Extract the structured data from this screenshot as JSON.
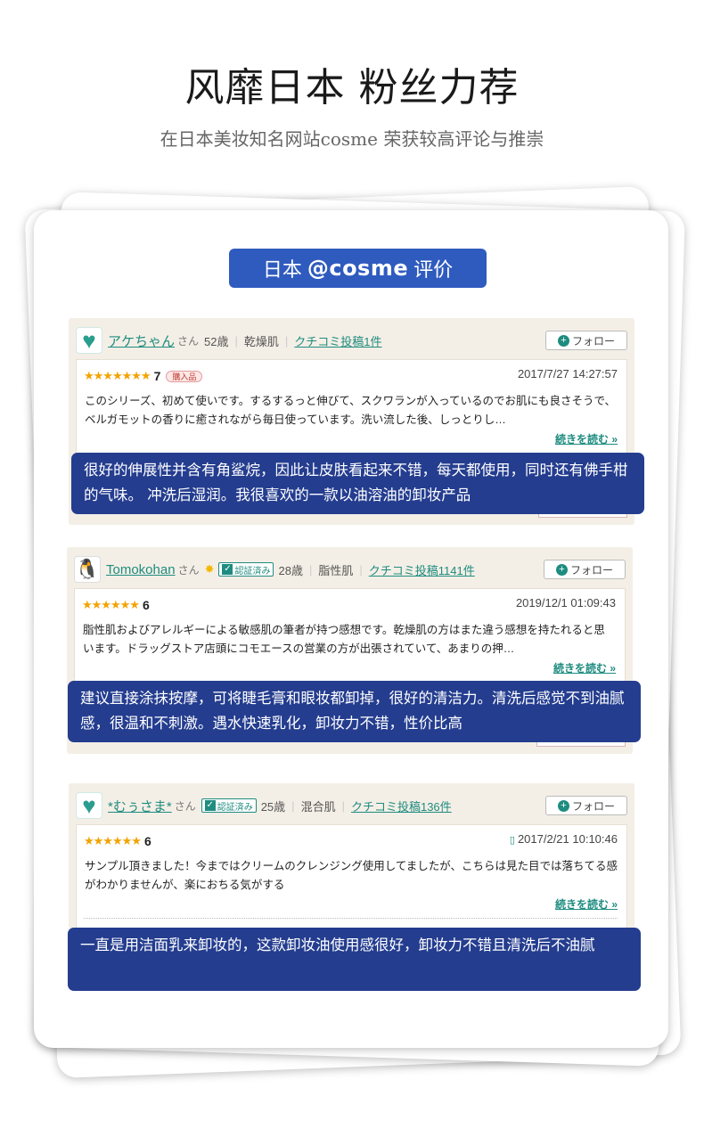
{
  "header": {
    "title": "风靡日本 粉丝力荐",
    "subtitle": "在日本美妆知名网站cosme 荣获较高评论与推崇"
  },
  "badge": {
    "prefix": "日本",
    "brand": "@cosme",
    "suffix": "评价"
  },
  "colors": {
    "accent": "#2f5bbf",
    "overlay": "#243d8f",
    "link": "#1e8c80",
    "star": "#f3a300"
  },
  "reviews": [
    {
      "avatar_icon": "heart-icon",
      "username": "アケちゃん",
      "san": "さん",
      "age": "52歳",
      "skin": "乾燥肌",
      "posts": "クチコミ投稿1件",
      "follow": "フォロー",
      "stars": "★★★★★★★",
      "score": "7",
      "purchased": "購入品",
      "date": "2017/7/27 14:27:57",
      "text": "このシリーズ、初めて使いです。するするっと伸びて、スクワランが入っているのでお肌にも良さそうで、ベルガモットの香りに癒されながら毎日使っています。洗い流した後、しっとりし…",
      "read_more": "続きを読む",
      "translation": "很好的伸展性并含有角鲨烷，因此让皮肤看起来不错，每天都使用，同时还有佛手柑的气味。 冲洗后湿润。我很喜欢的一款以油溶油的卸妆产品"
    },
    {
      "avatar_icon": "penguin-icon",
      "username": "Tomokohan",
      "san": "さん",
      "verified": "認証済み",
      "age": "28歳",
      "skin": "脂性肌",
      "posts": "クチコミ投稿1141件",
      "follow": "フォロー",
      "stars": "★★★★★★",
      "score": "6",
      "date": "2019/12/1 01:09:43",
      "text": "脂性肌およびアレルギーによる敏感肌の筆者が持つ感想です。乾燥肌の方はまた違う感想を持たれると思います。ドラッグストア店頭にコモエースの営業の方が出張されていて、あまりの押…",
      "read_more": "続きを読む",
      "translation": "建议直接涂抹按摩，可将睫毛膏和眼妆都卸掉，很好的清洁力。清洗后感觉不到油腻感，很温和不刺激。遇水快速乳化，卸妆力不错，性价比高"
    },
    {
      "avatar_icon": "heart-icon",
      "username": "*むぅさま*",
      "san": "さん",
      "verified": "認証済み",
      "age": "25歳",
      "skin": "混合肌",
      "posts": "クチコミ投稿136件",
      "follow": "フォロー",
      "stars": "★★★★★★",
      "score": "6",
      "date": "2017/2/21 10:10:46",
      "text": "サンプル頂きました！今まではクリームのクレンジング使用してましたが、こちらは見た目では落ちてる感がわかりませんが、楽におちる気がする",
      "read_more": "続きを読む",
      "translation": "一直是用洁面乳来卸妆的，这款卸妆油使用感很好，卸妆力不错且清洗后不油腻"
    }
  ]
}
